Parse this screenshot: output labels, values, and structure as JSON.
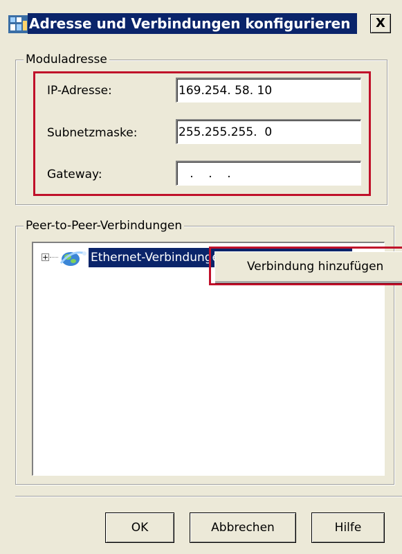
{
  "window": {
    "title": "Adresse und Verbindungen konfigurieren",
    "close_label": "X"
  },
  "module_address": {
    "legend": "Moduladresse",
    "ip_label": "IP-Adresse:",
    "ip_value": "169.254. 58. 10",
    "subnet_label": "Subnetzmaske:",
    "subnet_value": "255.255.255.  0",
    "gateway_label": "Gateway:",
    "gateway_value": "   .    .    ."
  },
  "peer_connections": {
    "legend": "Peer-to-Peer-Verbindungen",
    "tree_items": [
      {
        "label": "Ethernet-Verbindungen",
        "expander": "+"
      }
    ],
    "context_menu": {
      "items": [
        "Verbindung hinzufügen"
      ]
    }
  },
  "buttons": {
    "ok": "OK",
    "cancel": "Abbrechen",
    "help": "Hilfe"
  },
  "colors": {
    "dialog_bg": "#ece9d8",
    "selection": "#0a246a",
    "highlight_frame": "#c0102a"
  }
}
